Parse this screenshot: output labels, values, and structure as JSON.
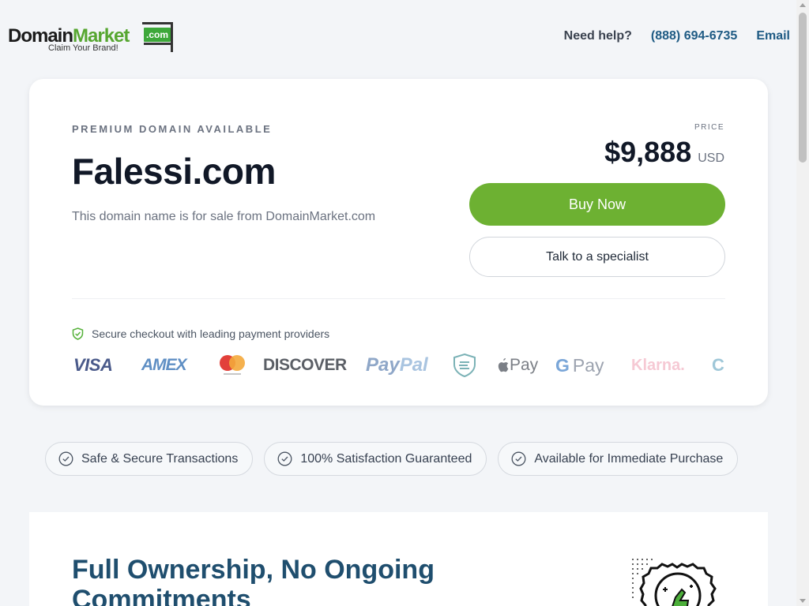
{
  "header": {
    "logo": {
      "word_dark": "Domain",
      "word_green": "Market",
      "com": ".com",
      "tagline": "Claim Your Brand!"
    },
    "nav": {
      "help": "Need help?",
      "phone": "(888) 694-6735",
      "email": "Email"
    }
  },
  "listing": {
    "eyebrow": "PREMIUM DOMAIN AVAILABLE",
    "domain": "Falessi.com",
    "description": "This domain name is for sale from DomainMarket.com",
    "price_label": "PRICE",
    "price": "$9,888",
    "currency": "USD",
    "buy_label": "Buy Now",
    "talk_label": "Talk to a specialist",
    "secure_text": "Secure checkout with leading payment providers",
    "payments": {
      "visa": "VISA",
      "amex": "AMEX",
      "discover": "DISCOVER",
      "paypal_a": "Pay",
      "paypal_b": "Pal",
      "applepay": "Pay",
      "gpay_g": "G",
      "gpay": "Pay",
      "klarna": "Klarna.",
      "cpay": "C"
    }
  },
  "badges": [
    "Safe & Secure Transactions",
    "100% Satisfaction Guaranteed",
    "Available for Immediate Purchase"
  ],
  "section2": {
    "heading": "Full Ownership, No Ongoing Commitments"
  },
  "colors": {
    "accent_green": "#6db132",
    "link_blue": "#1f5b84",
    "heading_blue": "#1f4e6e"
  }
}
